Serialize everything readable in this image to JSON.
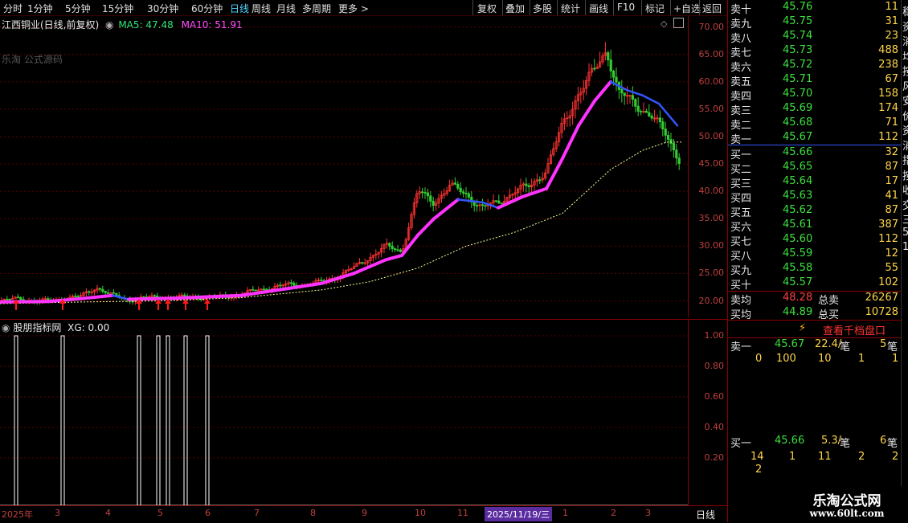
{
  "toolbar": {
    "items": [
      "分时",
      "1分钟",
      "5分钟",
      "15分钟",
      "30分钟",
      "60分钟",
      "日线",
      "周线",
      "月线",
      "多周期",
      "更多 >"
    ],
    "active": "日线",
    "right_items": [
      "复权",
      "叠加",
      "多股",
      "统计",
      "画线",
      "F10",
      "标记",
      "+自选",
      "返回"
    ]
  },
  "chart": {
    "title": "江西铜业(日线,前复权)",
    "ma5_label": "MA5: 47.48",
    "ma10_label": "MA10: 51.91",
    "watermark": "乐淘 公式源码",
    "y_ticks": [
      "70.00",
      "65.00",
      "60.00",
      "55.00",
      "50.00",
      "45.00",
      "40.00",
      "35.00",
      "30.00",
      "25.00",
      "20.00"
    ],
    "y_min": 17.0,
    "y_max": 72.0,
    "colors": {
      "up": "#ff3333",
      "down": "#33cc33",
      "ma5": "#ff33ff",
      "ma10": "#3355ff",
      "ma_long": "#ffff99",
      "arrow": "#ff1a1a"
    }
  },
  "indicator": {
    "title": "股朋指标网",
    "xg_label": "XG: 0.00",
    "y_ticks": [
      "1.00",
      "0.80",
      "0.60",
      "0.40",
      "0.20"
    ]
  },
  "x_axis": {
    "labels": [
      "2025年",
      "3",
      "4",
      "5",
      "6",
      "7",
      "8",
      "9",
      "10",
      "11",
      "1",
      "2",
      "3"
    ],
    "highlight": "2025/11/19/三",
    "period": "日线"
  },
  "chart_data": {
    "type": "candlestick",
    "title": "江西铜业(日线,前复权)",
    "ylim": [
      17,
      72
    ],
    "close_points": [
      [
        0,
        20.0
      ],
      [
        20,
        20.4
      ],
      [
        40,
        20.1
      ],
      [
        60,
        20.0
      ],
      [
        80,
        20.5
      ],
      [
        100,
        20.8
      ],
      [
        120,
        22.5
      ],
      [
        140,
        21.0
      ],
      [
        160,
        20.2
      ],
      [
        180,
        20.6
      ],
      [
        200,
        20.7
      ],
      [
        220,
        20.6
      ],
      [
        240,
        20.8
      ],
      [
        260,
        20.5
      ],
      [
        280,
        20.9
      ],
      [
        300,
        21.2
      ],
      [
        320,
        22.0
      ],
      [
        340,
        22.5
      ],
      [
        360,
        23.0
      ],
      [
        380,
        22.8
      ],
      [
        400,
        23.5
      ],
      [
        420,
        24.5
      ],
      [
        440,
        26.0
      ],
      [
        460,
        28.0
      ],
      [
        480,
        30.0
      ],
      [
        500,
        29.0
      ],
      [
        520,
        40.0
      ],
      [
        540,
        38.0
      ],
      [
        560,
        41.0
      ],
      [
        580,
        39.5
      ],
      [
        600,
        37.0
      ],
      [
        620,
        38.0
      ],
      [
        640,
        40.0
      ],
      [
        660,
        41.0
      ],
      [
        680,
        44.0
      ],
      [
        700,
        52.0
      ],
      [
        720,
        58.0
      ],
      [
        740,
        62.0
      ],
      [
        755,
        66.0
      ],
      [
        770,
        58.0
      ],
      [
        790,
        56.0
      ],
      [
        810,
        54.0
      ],
      [
        830,
        50.0
      ],
      [
        845,
        46.0
      ]
    ],
    "ma5_points": [
      [
        0,
        19.8
      ],
      [
        60,
        19.9
      ],
      [
        100,
        20.4
      ],
      [
        140,
        21.0
      ],
      [
        160,
        20.3
      ],
      [
        220,
        20.5
      ],
      [
        300,
        21.0
      ],
      [
        360,
        22.3
      ],
      [
        400,
        23.2
      ],
      [
        440,
        25.0
      ],
      [
        480,
        27.5
      ],
      [
        500,
        28.3
      ],
      [
        520,
        32.0
      ],
      [
        540,
        35.0
      ],
      [
        570,
        38.5
      ],
      [
        600,
        38.0
      ],
      [
        620,
        37.0
      ],
      [
        650,
        39.0
      ],
      [
        680,
        40.5
      ],
      [
        700,
        46.0
      ],
      [
        720,
        52.0
      ],
      [
        740,
        56.5
      ],
      [
        760,
        60.0
      ],
      [
        780,
        58.5
      ],
      [
        800,
        57.5
      ],
      [
        820,
        56.0
      ],
      [
        843,
        52.0
      ]
    ],
    "ma_long_points": [
      [
        0,
        19.5
      ],
      [
        100,
        19.8
      ],
      [
        200,
        20.0
      ],
      [
        300,
        20.6
      ],
      [
        400,
        22.0
      ],
      [
        460,
        23.5
      ],
      [
        520,
        26.0
      ],
      [
        580,
        30.0
      ],
      [
        640,
        32.5
      ],
      [
        700,
        36.0
      ],
      [
        760,
        44.0
      ],
      [
        800,
        47.5
      ],
      [
        830,
        49.0
      ],
      [
        850,
        49.0
      ]
    ],
    "signals_x": [
      20,
      78,
      173,
      197,
      209,
      231,
      258
    ]
  },
  "order_book": {
    "sells": [
      {
        "label": "卖十",
        "price": "45.76",
        "vol": "11"
      },
      {
        "label": "卖九",
        "price": "45.75",
        "vol": "31"
      },
      {
        "label": "卖八",
        "price": "45.74",
        "vol": "23"
      },
      {
        "label": "卖七",
        "price": "45.73",
        "vol": "488"
      },
      {
        "label": "卖六",
        "price": "45.72",
        "vol": "238"
      },
      {
        "label": "卖五",
        "price": "45.71",
        "vol": "67"
      },
      {
        "label": "卖四",
        "price": "45.70",
        "vol": "158"
      },
      {
        "label": "卖三",
        "price": "45.69",
        "vol": "174"
      },
      {
        "label": "卖二",
        "price": "45.68",
        "vol": "71"
      },
      {
        "label": "卖一",
        "price": "45.67",
        "vol": "112"
      }
    ],
    "buys": [
      {
        "label": "买一",
        "price": "45.66",
        "vol": "32"
      },
      {
        "label": "买二",
        "price": "45.65",
        "vol": "87"
      },
      {
        "label": "买三",
        "price": "45.64",
        "vol": "17"
      },
      {
        "label": "买四",
        "price": "45.63",
        "vol": "41"
      },
      {
        "label": "买五",
        "price": "45.62",
        "vol": "87"
      },
      {
        "label": "买六",
        "price": "45.61",
        "vol": "387"
      },
      {
        "label": "买七",
        "price": "45.60",
        "vol": "112"
      },
      {
        "label": "买八",
        "price": "45.59",
        "vol": "12"
      },
      {
        "label": "买九",
        "price": "45.58",
        "vol": "55"
      },
      {
        "label": "买十",
        "price": "45.57",
        "vol": "102"
      }
    ],
    "avg_sell_label": "卖均",
    "avg_sell_price": "48.28",
    "total_sell_label": "总卖",
    "total_sell": "26267",
    "avg_buy_label": "买均",
    "avg_buy_price": "44.89",
    "total_buy_label": "总买",
    "total_buy": "10728"
  },
  "queue": {
    "link": "查看千档盘口",
    "sell1": {
      "label": "卖一",
      "price": "45.67",
      "vol": "22.4/",
      "unit": "笔",
      "count": "5",
      "unit2": "笔",
      "items": [
        "0",
        "100",
        "10",
        "1",
        "1"
      ]
    },
    "buy1": {
      "label": "买一",
      "price": "45.66",
      "vol": "5.3/",
      "unit": "笔",
      "count": "6",
      "unit2": "笔",
      "items": [
        "14",
        "1",
        "11",
        "2",
        "2",
        "2"
      ]
    }
  },
  "branding": {
    "name": "乐淘公式网",
    "url": "www.60lt.com"
  },
  "far_right_text": [
    "稳",
    "资",
    "消",
    "均",
    "按",
    "风",
    "安",
    "价",
    "资",
    "消",
    "指",
    "按",
    "收",
    "交",
    "三",
    "5",
    "1"
  ]
}
